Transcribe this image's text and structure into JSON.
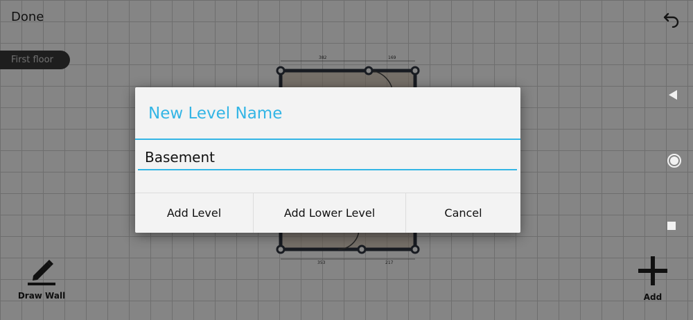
{
  "header": {
    "done_label": "Done"
  },
  "level_chip": {
    "label": "First floor"
  },
  "plan": {
    "dim_top_left": "382",
    "dim_top_right": "169",
    "dim_bottom_left": "353",
    "dim_bottom_right": "217"
  },
  "toolbar": {
    "draw_wall_label": "Draw Wall",
    "add_label": "Add"
  },
  "dialog": {
    "title": "New Level Name",
    "input_value": "Basement",
    "buttons": {
      "add_level": "Add Level",
      "add_lower_level": "Add Lower Level",
      "cancel": "Cancel"
    }
  },
  "icons": {
    "undo": "undo-icon",
    "back": "back-triangle-icon",
    "home": "home-circle-icon",
    "recent": "recent-square-icon",
    "pencil": "pencil-icon",
    "plus": "plus-icon"
  },
  "colors": {
    "accent": "#33b5e5",
    "chip_bg": "#3b3b3b",
    "wall": "#2f3440"
  }
}
